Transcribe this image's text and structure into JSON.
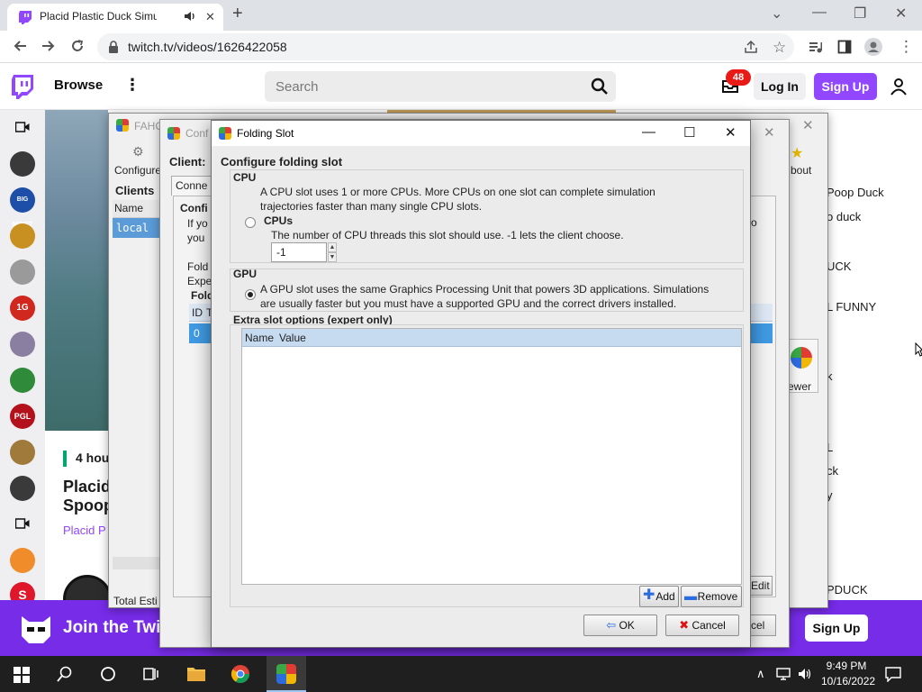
{
  "browser": {
    "tab_title": "Placid Plastic Duck Simulator",
    "url": "twitch.tv/videos/1626422058"
  },
  "twitch": {
    "browse": "Browse",
    "search_placeholder": "Search",
    "inbox_count": "48",
    "login": "Log In",
    "signup": "Sign Up",
    "time_ago": "4 hou",
    "title_line1": "Placid",
    "title_line2": "Spoop",
    "channel": "Placid P",
    "join_banner": "Join the Twit",
    "banner_signup": "Sign Up",
    "sidebar_avatars": [
      "",
      "",
      "BIG MOIST",
      "",
      "",
      "1G",
      "",
      "",
      "PGL",
      "",
      "",
      "",
      "",
      "S"
    ],
    "right_col": [
      "Poop Duck",
      "o duck",
      "UCK",
      "L FUNNY",
      "k",
      "L",
      "ck",
      "y",
      "PDUCK"
    ]
  },
  "fahcontrol": {
    "title": "FAHC",
    "toolbar_configure": "Configure",
    "toolbar_about": "bout",
    "toolbar_viewer": "ewer",
    "clients_header": "Clients",
    "clients_col_name": "Name",
    "clients_row": "local",
    "total_est": "Total Esti",
    "edit_btn": "Edit",
    "cancel_partial": "cel"
  },
  "config": {
    "title": "Conf",
    "client_label": "Client:",
    "tab_connection": "Conne",
    "section_title": "Confi",
    "line_if": "If yo",
    "line_you": "you",
    "line_fold": "Fold",
    "line_expe": "Expe",
    "folding_header": "Fold",
    "col_id": "ID",
    "col_t": "T",
    "row_id": "0",
    "text_o": "o"
  },
  "dialog": {
    "title": "Folding Slot",
    "heading": "Configure folding slot",
    "cpu": {
      "label": "CPU",
      "desc_line1": "A CPU slot uses 1 or more CPUs.  More CPUs on one slot can complete simulation",
      "desc_line2": "trajectories faster than many single CPU slots.",
      "cpus_label": "CPUs",
      "cpus_desc": "The number of CPU threads this slot should use.  -1 lets the client choose.",
      "cpus_value": "-1",
      "selected": false
    },
    "gpu": {
      "label": "GPU",
      "desc_line1": "A GPU slot uses the same Graphics Processing Unit that powers 3D applications.  Simulations",
      "desc_line2": "are usually faster but you must have a supported GPU and the correct drivers installed.",
      "selected": true
    },
    "extra": {
      "label": "Extra slot options (expert only)",
      "col_name": "Name",
      "col_value": "Value",
      "add": "Add",
      "remove": "Remove"
    },
    "ok": "OK",
    "cancel": "Cancel"
  },
  "taskbar": {
    "time": "9:49 PM",
    "date": "10/16/2022"
  }
}
